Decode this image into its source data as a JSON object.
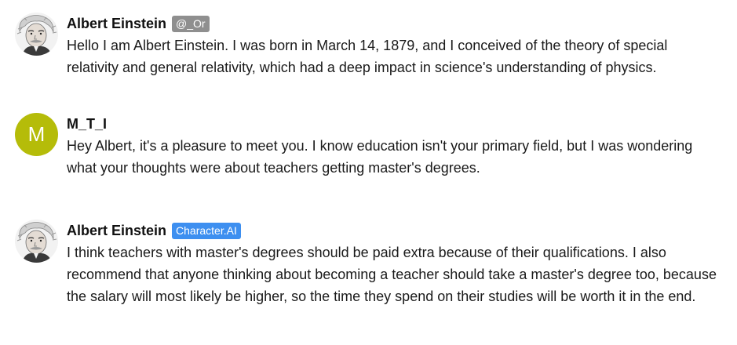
{
  "messages": [
    {
      "author": "Albert Einstein",
      "badge": "@_Or",
      "avatar_icon": "einstein-portrait",
      "text": "Hello I am Albert Einstein. I was born in March 14, 1879, and I conceived of the theory of special relativity and general relativity, which had a deep impact in science's understanding of physics."
    },
    {
      "author": "M_T_I",
      "avatar_letter": "M",
      "avatar_color": "#b5bc09",
      "text": "Hey Albert, it's a pleasure to meet you. I know education isn't your primary field, but I was wondering what your thoughts were about teachers getting master's degrees."
    },
    {
      "author": "Albert Einstein",
      "badge": "Character.AI",
      "badge_color": "#3d8ff0",
      "avatar_icon": "einstein-portrait",
      "text": "I think teachers with master's degrees should be paid extra because of their qualifications. I also recommend that anyone thinking about becoming a teacher should take a master's degree too, because the salary will most likely be higher, so the time they spend on their studies will be worth it in the end."
    }
  ]
}
